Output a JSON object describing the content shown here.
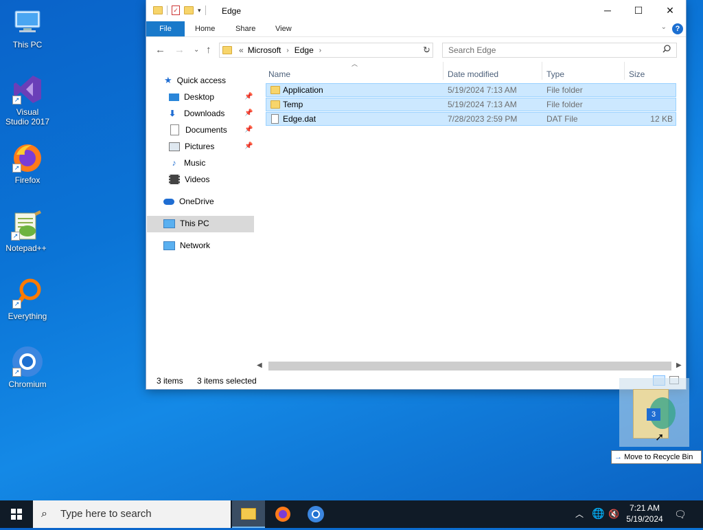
{
  "desktop": {
    "icons": [
      {
        "label": "This PC"
      },
      {
        "label": "Visual Studio 2017"
      },
      {
        "label": "Firefox"
      },
      {
        "label": "Notepad++"
      },
      {
        "label": "Everything"
      },
      {
        "label": "Chromium"
      }
    ]
  },
  "window": {
    "title": "Edge",
    "controls": {
      "minimize": "─",
      "maximize": "☐",
      "close": "✕"
    },
    "ribbon": {
      "file": "File",
      "home": "Home",
      "share": "Share",
      "view": "View",
      "help": "?"
    },
    "address": {
      "overflow": "«",
      "segments": [
        "Microsoft",
        "Edge"
      ]
    },
    "search": {
      "placeholder": "Search Edge"
    },
    "nav": {
      "quick_access": "Quick access",
      "pinned": [
        {
          "label": "Desktop"
        },
        {
          "label": "Downloads"
        },
        {
          "label": "Documents"
        },
        {
          "label": "Pictures"
        }
      ],
      "music": "Music",
      "videos": "Videos",
      "onedrive": "OneDrive",
      "this_pc": "This PC",
      "network": "Network"
    },
    "columns": {
      "name": "Name",
      "date": "Date modified",
      "type": "Type",
      "size": "Size"
    },
    "files": [
      {
        "name": "Application",
        "date": "5/19/2024 7:13 AM",
        "type": "File folder",
        "size": "",
        "kind": "folder"
      },
      {
        "name": "Temp",
        "date": "5/19/2024 7:13 AM",
        "type": "File folder",
        "size": "",
        "kind": "folder"
      },
      {
        "name": "Edge.dat",
        "date": "7/28/2023 2:59 PM",
        "type": "DAT File",
        "size": "12 KB",
        "kind": "file"
      }
    ],
    "status": {
      "items": "3 items",
      "selected": "3 items selected"
    }
  },
  "drag": {
    "count": "3",
    "tooltip": "Move to Recycle Bin",
    "arrow": "→"
  },
  "taskbar": {
    "search_placeholder": "Type here to search",
    "time": "7:21 AM",
    "date": "5/19/2024"
  },
  "colors": {
    "selection": "#cce8ff",
    "selection_border": "#99d1ff",
    "accent": "#1979ca",
    "taskbar": "#101b27"
  }
}
